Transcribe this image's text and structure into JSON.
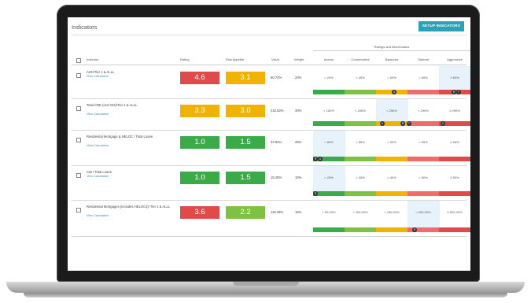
{
  "header": {
    "title": "Indicators",
    "setup_label": "SETUP INDICATORS"
  },
  "columns": {
    "indicator": "Indicator",
    "rating": "Rating",
    "risk_appetite": "Risk Appetite",
    "value": "Value",
    "weight": "Weight",
    "bench_group": "Ratings and Benchmarks",
    "bench": [
      "Averse",
      "Conservative",
      "Balanced",
      "Tolerant",
      "Aggressive"
    ]
  },
  "colors": {
    "red": "#e04a4a",
    "orange": "#f0b400",
    "green": "#3bab4a",
    "lightgreen": "#7dc242",
    "lightred": "#f06b6b"
  },
  "rows": [
    {
      "name": "ADC/Tier 1 & ALLL",
      "link": "View Calculation",
      "rating": "4.6",
      "rating_color": "red",
      "appetite": "3.1",
      "appetite_color": "orange",
      "value": "80.74%",
      "weight": "20%",
      "bench": [
        "< 20%",
        "< 40%",
        "< 50%",
        "< 60%",
        "≥ 60%"
      ],
      "highlight": 4,
      "bar": [
        "green",
        "lightgreen",
        "orange",
        "lightred",
        "red"
      ],
      "markers": [
        "A",
        "R",
        "T"
      ]
    },
    {
      "name": "Total CRE (excl OO)/Tier 1 & ALLL",
      "link": "View Calculation",
      "rating": "3.3",
      "rating_color": "orange",
      "appetite": "3.0",
      "appetite_color": "orange",
      "value": "242.82%",
      "weight": "30%",
      "bench": [
        "< 100%",
        "< 200%",
        "< 250%",
        "< 290%",
        "≥ 290%"
      ],
      "highlight": 2,
      "bar": [
        "green",
        "lightgreen",
        "orange",
        "lightred",
        "red"
      ],
      "markers": [
        "A",
        "R",
        "T",
        "C"
      ]
    },
    {
      "name": "Residential Mortgage & HELOC / Total Loans",
      "link": "View Calculation",
      "rating": "1.0",
      "rating_color": "green",
      "appetite": "1.5",
      "appetite_color": "green",
      "value": "24.92%",
      "weight": "25%",
      "bench": [
        "< 80%",
        "< 85%",
        "< 90%",
        "< 95%",
        "≥ 95%"
      ],
      "highlight": 0,
      "bar": [
        "green",
        "lightgreen",
        "orange",
        "lightred",
        "red"
      ],
      "markers": [
        "R",
        "A"
      ]
    },
    {
      "name": "C&I / Total Loans",
      "link": "View Calculation",
      "rating": "1.0",
      "rating_color": "green",
      "appetite": "1.5",
      "appetite_color": "green",
      "value": "15.26%",
      "weight": "10%",
      "bench": [
        "< 25%",
        "< 35%",
        "< 40%",
        "< 50%",
        "≥ 50%"
      ],
      "highlight": 0,
      "bar": [
        "green",
        "lightgreen",
        "orange",
        "lightred",
        "red"
      ],
      "markers": [
        "R"
      ]
    },
    {
      "name": "Residential Mortgages (includes HELOCs)/ Tier 1 & ALLL",
      "link": "View Calculation",
      "rating": "3.6",
      "rating_color": "red",
      "appetite": "2.2",
      "appetite_color": "lightgreen",
      "value": "119.29%",
      "weight": "15%",
      "bench": [
        "< 50.00%",
        "< 100.00%",
        "< 150.00%",
        "< 200.00%",
        "≥ 200.00%"
      ],
      "highlight": 3,
      "bar": [
        "green",
        "lightgreen",
        "orange",
        "lightred",
        "red"
      ],
      "markers": [
        "R"
      ]
    }
  ]
}
